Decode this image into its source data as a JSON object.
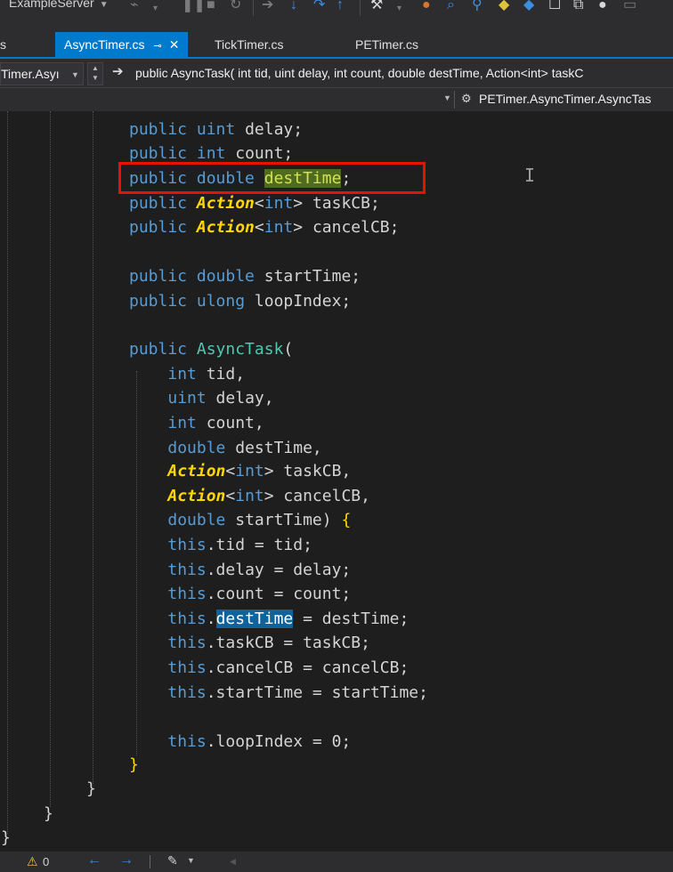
{
  "toolbar": {
    "config_label": "ExampleServer",
    "icons": [
      "attach-icon",
      "pause-icon",
      "stop-icon",
      "restart-icon",
      "step-over-icon",
      "step-into-icon",
      "step-out-icon",
      "diagnostics-icon",
      "breakpoint-icon",
      "find-icon",
      "bookmark-icon",
      "window-icon",
      "settings-icon"
    ]
  },
  "tabs": [
    {
      "label": "s"
    },
    {
      "label": "AsyncTimer.cs",
      "active": true
    },
    {
      "label": "TickTimer.cs"
    },
    {
      "label": "PETimer.cs"
    }
  ],
  "nav": {
    "type_combo": "Timer.Asyı",
    "member_signature": "public AsyncTask( int tid, uint delay, int count, double destTime, Action<int> taskC",
    "class_path": "PETimer.AsyncTimer.AsyncTas"
  },
  "code": {
    "lines": [
      [
        {
          "t": "public",
          "c": "kw"
        },
        {
          "t": " "
        },
        {
          "t": "uint",
          "c": "kw"
        },
        {
          "t": " delay;"
        }
      ],
      [
        {
          "t": "public",
          "c": "kw"
        },
        {
          "t": " "
        },
        {
          "t": "int",
          "c": "kw"
        },
        {
          "t": " count;"
        }
      ],
      [
        {
          "t": "public",
          "c": "kw"
        },
        {
          "t": " "
        },
        {
          "t": "double",
          "c": "kw"
        },
        {
          "t": " "
        },
        {
          "t": "destTime",
          "c": "hl-green"
        },
        {
          "t": ";"
        }
      ],
      [
        {
          "t": "public",
          "c": "kw"
        },
        {
          "t": " "
        },
        {
          "t": "Action",
          "c": "dl"
        },
        {
          "t": "<"
        },
        {
          "t": "int",
          "c": "kw"
        },
        {
          "t": "> taskCB;"
        }
      ],
      [
        {
          "t": "public",
          "c": "kw"
        },
        {
          "t": " "
        },
        {
          "t": "Action",
          "c": "dl"
        },
        {
          "t": "<"
        },
        {
          "t": "int",
          "c": "kw"
        },
        {
          "t": "> cancelCB;"
        }
      ],
      [],
      [
        {
          "t": "public",
          "c": "kw"
        },
        {
          "t": " "
        },
        {
          "t": "double",
          "c": "kw"
        },
        {
          "t": " startTime;"
        }
      ],
      [
        {
          "t": "public",
          "c": "kw"
        },
        {
          "t": " "
        },
        {
          "t": "ulong",
          "c": "kw"
        },
        {
          "t": " loopIndex;"
        }
      ],
      [],
      [
        {
          "t": "public",
          "c": "kw"
        },
        {
          "t": " "
        },
        {
          "t": "AsyncTask",
          "c": "ty"
        },
        {
          "t": "("
        }
      ],
      [
        {
          "t": "    "
        },
        {
          "t": "int",
          "c": "kw"
        },
        {
          "t": " tid,"
        }
      ],
      [
        {
          "t": "    "
        },
        {
          "t": "uint",
          "c": "kw"
        },
        {
          "t": " delay,"
        }
      ],
      [
        {
          "t": "    "
        },
        {
          "t": "int",
          "c": "kw"
        },
        {
          "t": " count,"
        }
      ],
      [
        {
          "t": "    "
        },
        {
          "t": "double",
          "c": "kw"
        },
        {
          "t": " destTime,"
        }
      ],
      [
        {
          "t": "    "
        },
        {
          "t": "Action",
          "c": "dl"
        },
        {
          "t": "<"
        },
        {
          "t": "int",
          "c": "kw"
        },
        {
          "t": "> taskCB,"
        }
      ],
      [
        {
          "t": "    "
        },
        {
          "t": "Action",
          "c": "dl"
        },
        {
          "t": "<"
        },
        {
          "t": "int",
          "c": "kw"
        },
        {
          "t": "> cancelCB,"
        }
      ],
      [
        {
          "t": "    "
        },
        {
          "t": "double",
          "c": "kw"
        },
        {
          "t": " startTime) "
        },
        {
          "t": "{",
          "c": "br"
        }
      ],
      [
        {
          "t": "    "
        },
        {
          "t": "this",
          "c": "kw"
        },
        {
          "t": ".tid = tid;"
        }
      ],
      [
        {
          "t": "    "
        },
        {
          "t": "this",
          "c": "kw"
        },
        {
          "t": ".delay = delay;"
        }
      ],
      [
        {
          "t": "    "
        },
        {
          "t": "this",
          "c": "kw"
        },
        {
          "t": ".count = count;"
        }
      ],
      [
        {
          "t": "    "
        },
        {
          "t": "this",
          "c": "kw"
        },
        {
          "t": "."
        },
        {
          "t": "destTime",
          "c": "hl-blue"
        },
        {
          "t": " = destTime;"
        }
      ],
      [
        {
          "t": "    "
        },
        {
          "t": "this",
          "c": "kw"
        },
        {
          "t": ".taskCB = taskCB;"
        }
      ],
      [
        {
          "t": "    "
        },
        {
          "t": "this",
          "c": "kw"
        },
        {
          "t": ".cancelCB = cancelCB;"
        }
      ],
      [
        {
          "t": "    "
        },
        {
          "t": "this",
          "c": "kw"
        },
        {
          "t": ".startTime = startTime;"
        }
      ],
      [],
      [
        {
          "t": "    "
        },
        {
          "t": "this",
          "c": "kw"
        },
        {
          "t": ".loopIndex = 0;"
        }
      ],
      [
        {
          "t": "}",
          "c": "br"
        }
      ],
      [
        {
          "t": "}"
        }
      ],
      [
        {
          "t": "}"
        }
      ],
      [
        {
          "t": "}"
        }
      ]
    ]
  },
  "status": {
    "warning_count": "0"
  }
}
